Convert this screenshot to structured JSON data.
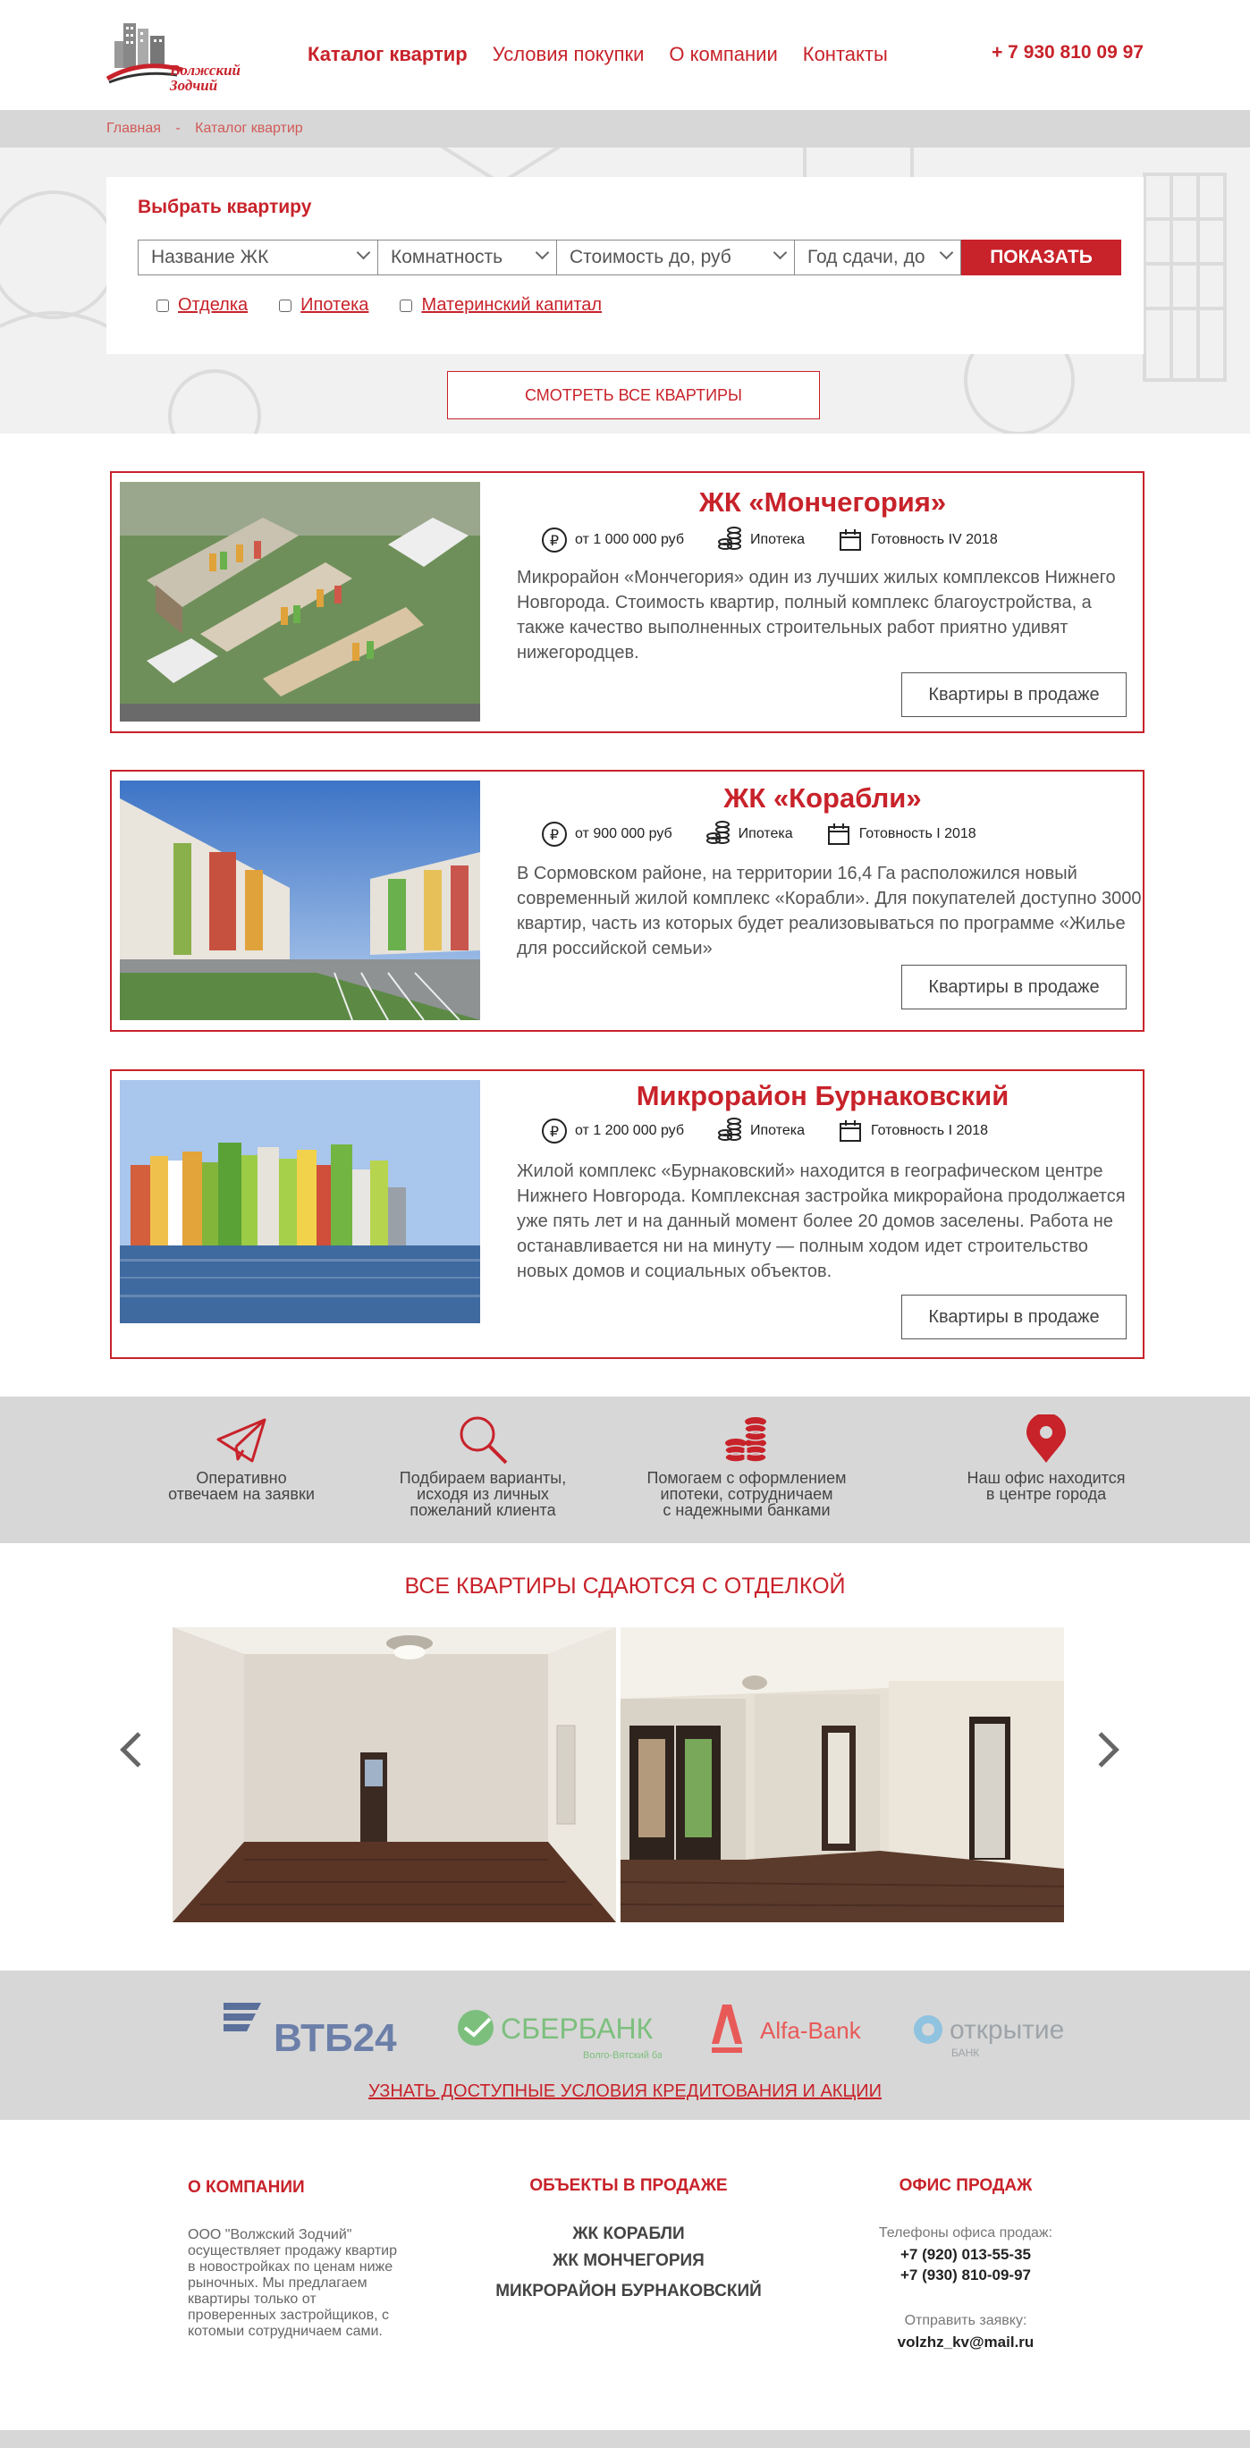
{
  "header": {
    "logo_text_line1": "Волжский",
    "logo_text_line2": "Зодчий",
    "nav": [
      "Каталог квартир",
      "Условия покупки",
      "О компании",
      "Контакты"
    ],
    "phone": "+ 7 930 810 09 97"
  },
  "breadcrumb": [
    "Главная",
    "Каталог квартир"
  ],
  "breadcrumb_sep": "-",
  "search": {
    "title": "Выбрать квартиру",
    "filters": [
      "Название ЖК",
      "Комнатность",
      "Стоимость до, руб",
      "Год сдачи, до"
    ],
    "show_button": "ПОКАЗАТЬ",
    "checkboxes": [
      "Отделка",
      "Ипотека",
      "Материнский капитал"
    ],
    "all_button": "СМОТРЕТЬ ВСЕ КВАРТИРЫ"
  },
  "cards": [
    {
      "title": "ЖК «Мончегория»",
      "price": "от 1 000 000 руб",
      "mortgage": "Ипотека",
      "ready": "Готовность IV 2018",
      "description": "Микрорайон «Мончегория» один из лучших жилых комплексов Нижнего Новгорода. Стоимость квартир, полный комплекс благоустройства, а также качество выполненных строительных работ приятно удивят нижегородцев.",
      "button": "Квартиры в продаже"
    },
    {
      "title": "ЖК «Корабли»",
      "price": "от 900 000 руб",
      "mortgage": "Ипотека",
      "ready": "Готовность I 2018",
      "description": "В Сормовском районе, на территории 16,4 Га расположился новый современный жилой комплекс «Корабли». Для покупателей доступно 3000 квартир, часть из которых будет реализовываться по программе «Жилье для российской семьи»",
      "button": "Квартиры в продаже"
    },
    {
      "title": "Микрорайон Бурнаковский",
      "price": "от 1 200 000 руб",
      "mortgage": "Ипотека",
      "ready": "Готовность I 2018",
      "description": "Жилой комплекс «Бурнаковский» находится в географическом центре Нижнего Новгорода. Комплексная застройка микрорайона продолжается уже пять лет и на данный момент более 20 домов заселены. Работа не останавливается ни на минуту — полным ходом идет строительство новых домов и социальных объектов.",
      "button": "Квартиры в продаже"
    }
  ],
  "features": [
    {
      "icon": "paper-plane-icon",
      "lines": [
        "Оперативно",
        "отвечаем на заявки"
      ]
    },
    {
      "icon": "magnifier-icon",
      "lines": [
        "Подбираем варианты,",
        "исходя из личных",
        "пожеланий клиента"
      ]
    },
    {
      "icon": "coins-icon",
      "lines": [
        "Помогаем с оформлением",
        "ипотеки, сотрудничаем",
        "с надежными банками"
      ]
    },
    {
      "icon": "map-pin-icon",
      "lines": [
        "Наш офис находится",
        "в центре города"
      ]
    }
  ],
  "finishing_title": "ВСЕ КВАРТИРЫ СДАЮТСЯ С ОТДЕЛКОЙ",
  "banks": {
    "vtb": "ВТБ24",
    "sber": "СБЕРБАНК",
    "sber_sub": "Волго-Вятский банк",
    "alfa": "Alfa-Bank",
    "otkr": "открытие",
    "otkr_sub": "БАНК",
    "credit_link": "УЗНАТЬ ДОСТУПНЫЕ УСЛОВИЯ КРЕДИТОВАНИЯ И АКЦИИ"
  },
  "footer": {
    "about_title": "О КОМПАНИИ",
    "about_text": "ООО \"Волжский Зодчий\" осуществляет продажу квартир в новостройках по ценам ниже рыночных. Мы предлагаем квартиры только от проверенных застройщиков, с котомыи сотрудничаем сами.",
    "objects_title": "ОБЪЕКТЫ В ПРОДАЖЕ",
    "objects": [
      "ЖК КОРАБЛИ",
      "ЖК МОНЧЕГОРИЯ",
      "МИКРОРАЙОН БУРНАКОВСКИЙ"
    ],
    "office_title": "ОФИС ПРОДАЖ",
    "phones_label": "Телефоны офиса продаж:",
    "phone1": "+7 (920) 013-55-35",
    "phone2": "+7 (930) 810-09-97",
    "request_label": "Отправить заявку:",
    "email": "volzhz_kv@mail.ru"
  },
  "colors": {
    "accent": "#c8222a",
    "band": "#d7d7d7",
    "search_bg": "#f1f1f1"
  }
}
